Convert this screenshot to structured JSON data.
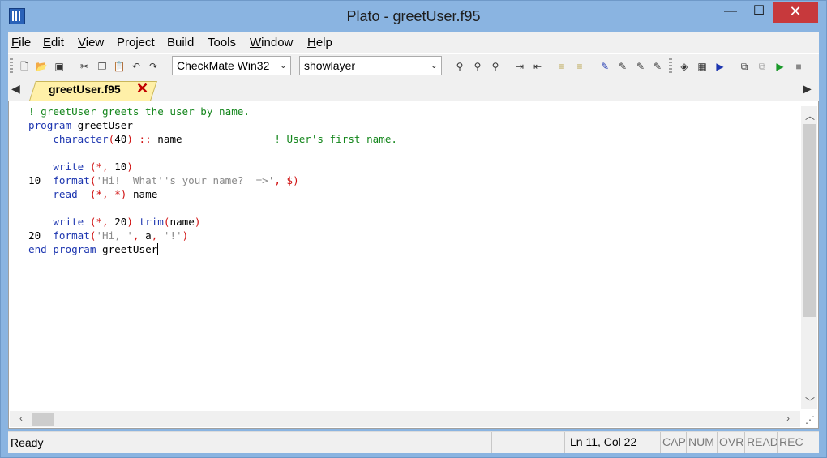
{
  "window": {
    "title": "Plato - greetUser.f95",
    "minimize": "—",
    "maximize": "☐",
    "close": "✕"
  },
  "menu": {
    "items": [
      {
        "label": "File",
        "mn": "F",
        "rest": "ile"
      },
      {
        "label": "Edit",
        "mn": "E",
        "rest": "dit"
      },
      {
        "label": "View",
        "mn": "V",
        "rest": "iew"
      },
      {
        "label": "Project",
        "mn": "",
        "rest": "Project"
      },
      {
        "label": "Build",
        "mn": "",
        "rest": "Build"
      },
      {
        "label": "Tools",
        "mn": "",
        "rest": "Tools"
      },
      {
        "label": "Window",
        "mn": "W",
        "rest": "indow"
      },
      {
        "label": "Help",
        "mn": "H",
        "rest": "elp"
      }
    ]
  },
  "toolbar": {
    "compiler_combo": "CheckMate Win32",
    "search_combo": "showlayer",
    "icons": [
      "new-file-icon",
      "open-folder-icon",
      "save-icon",
      "cut-icon",
      "copy-icon",
      "paste-icon",
      "undo-icon",
      "redo-icon",
      "find-icon",
      "find-next-icon",
      "replace-icon",
      "indent-icon",
      "outdent-icon",
      "comment-icon",
      "uncomment-icon",
      "toggle-bookmark-icon",
      "next-bookmark-icon",
      "prev-bookmark-icon",
      "clear-bookmarks-icon",
      "compile-icon",
      "build-icon",
      "run-icon",
      "debug-icon",
      "step-icon",
      "start-icon",
      "stop-icon"
    ]
  },
  "tab": {
    "label": "greetUser.f95",
    "close": "✕",
    "left_nav": "◀",
    "right_nav": "▶"
  },
  "editor": {
    "lines": [
      {
        "label": "",
        "code": "! greetUser greets the user by name."
      },
      {
        "label": "",
        "code": "program greetUser"
      },
      {
        "label": "",
        "code": "    character(40) :: name               ! User's first name."
      },
      {
        "label": "",
        "code": ""
      },
      {
        "label": "",
        "code": "    write (*, 10)"
      },
      {
        "label": "10",
        "code": "format('Hi!  What''s your name?  =>', $)"
      },
      {
        "label": "",
        "code": "    read  (*, *) name"
      },
      {
        "label": "",
        "code": ""
      },
      {
        "label": "",
        "code": "    write (*, 20) trim(name)"
      },
      {
        "label": "20",
        "code": "format('Hi, ', a, '!')"
      },
      {
        "label": "",
        "code": "end program greetUser"
      }
    ]
  },
  "status": {
    "ready": "Ready",
    "position": "Ln 11, Col 22",
    "indicators": [
      "CAP",
      "NUM",
      "OVR",
      "READ",
      "REC"
    ]
  },
  "colors": {
    "comment": "#14861c",
    "keyword": "#1d36b0",
    "string": "#8a8a8a",
    "punct": "#d01010",
    "tab_bg": "#fff0a8",
    "close_btn": "#c7393c"
  }
}
